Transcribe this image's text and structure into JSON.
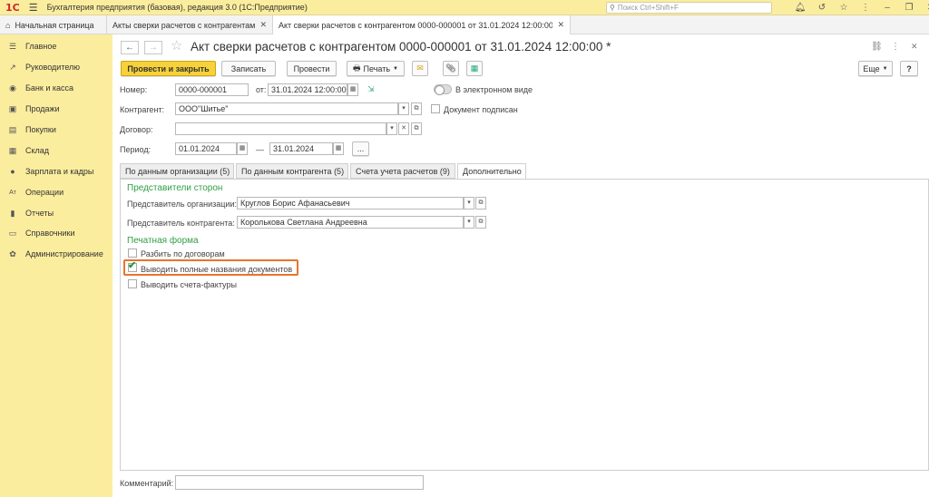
{
  "app": {
    "logo": "1С",
    "title": "Бухгалтерия предприятия (базовая), редакция 3.0  (1С:Предприятие)",
    "search_placeholder": "Поиск Ctrl+Shift+F"
  },
  "window_tabs": [
    {
      "label": "Начальная страница"
    },
    {
      "label": "Акты сверки расчетов с контрагентами"
    },
    {
      "label": "Акт сверки расчетов с контрагентом 0000-000001 от 31.01.2024 12:00:00 *"
    }
  ],
  "sidebar": {
    "items": [
      {
        "label": "Главное",
        "icon": "☰"
      },
      {
        "label": "Руководителю",
        "icon": "↗"
      },
      {
        "label": "Банк и касса",
        "icon": "◉"
      },
      {
        "label": "Продажи",
        "icon": "▣"
      },
      {
        "label": "Покупки",
        "icon": "▤"
      },
      {
        "label": "Склад",
        "icon": "▦"
      },
      {
        "label": "Зарплата и кадры",
        "icon": "●"
      },
      {
        "label": "Операции",
        "icon": "Ат"
      },
      {
        "label": "Отчеты",
        "icon": "▮"
      },
      {
        "label": "Справочники",
        "icon": "▭"
      },
      {
        "label": "Администрирование",
        "icon": "✿"
      }
    ]
  },
  "document": {
    "title": "Акт сверки расчетов с контрагентом 0000-000001 от 31.01.2024 12:00:00 *"
  },
  "toolbar": {
    "post_close": "Провести и закрыть",
    "save": "Записать",
    "post": "Провести",
    "print": "Печать",
    "more": "Еще",
    "help": "?"
  },
  "form": {
    "number_label": "Номер:",
    "number_value": "0000-000001",
    "from_label": "от:",
    "date_value": "31.01.2024 12:00:00",
    "electronic_label": "В электронном виде",
    "contractor_label": "Контрагент:",
    "contractor_value": "ООО\"Шитье\"",
    "signed_label": "Документ подписан",
    "contract_label": "Договор:",
    "contract_value": "",
    "period_label": "Период:",
    "period_from": "01.01.2024",
    "period_dash": "—",
    "period_to": "31.01.2024",
    "period_more": "...",
    "comment_label": "Комментарий:",
    "comment_value": ""
  },
  "form_tabs": [
    {
      "label": "По данным организации (5)"
    },
    {
      "label": "По данным контрагента (5)"
    },
    {
      "label": "Счета учета расчетов (9)"
    },
    {
      "label": "Дополнительно"
    }
  ],
  "additional": {
    "reps_title": "Представители сторон",
    "org_rep_label": "Представитель организации:",
    "org_rep_value": "Круглов Борис Афанасьевич",
    "contr_rep_label": "Представитель контрагента:",
    "contr_rep_value": "Королькова Светлана Андреевна",
    "print_title": "Печатная форма",
    "split_label": "Разбить по договорам",
    "split_checked": false,
    "full_names_label": "Выводить полные названия документов",
    "full_names_checked": true,
    "invoices_label": "Выводить счета-фактуры",
    "invoices_checked": false
  },
  "colors": {
    "sidebar_bg": "#fbed9e",
    "primary_button": "#f6d13a",
    "group_title": "#2f9e45",
    "highlight": "#e8742e"
  }
}
